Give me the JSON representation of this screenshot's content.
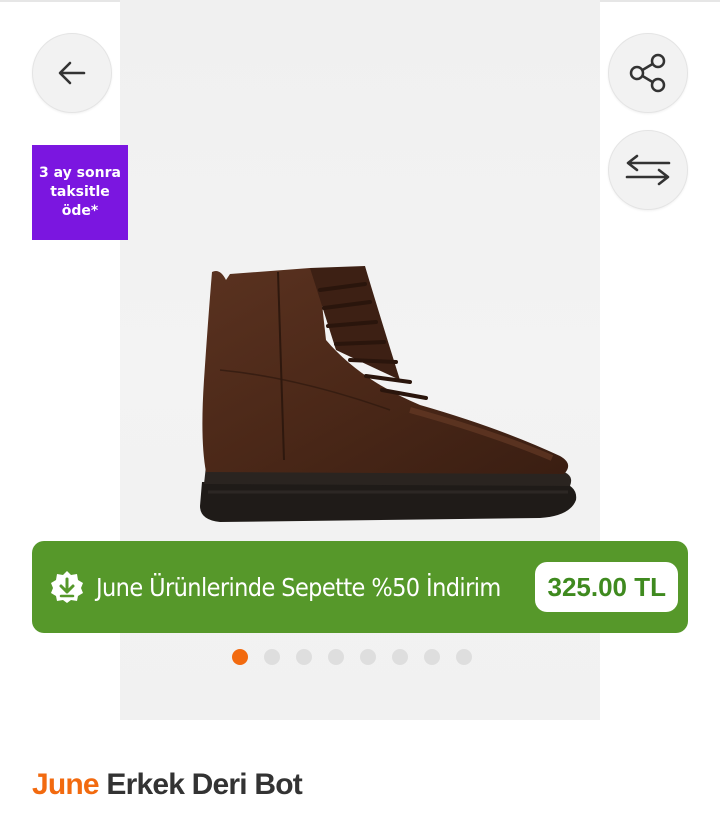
{
  "installment_badge": {
    "line1": "3 ay sonra",
    "line2": "taksitle",
    "line3": "öde*"
  },
  "promo": {
    "text": "June Ürünlerinde Sepette %50 İndirim",
    "price": "325.00 TL"
  },
  "gallery": {
    "total_images": 8,
    "active_index": 0
  },
  "product": {
    "brand": "June",
    "name": "Erkek Deri Bot"
  },
  "colors": {
    "accent": "#f26a0f",
    "promo_green": "#56982a",
    "badge_purple": "#7b16e0"
  },
  "icons": {
    "back": "arrow-left-icon",
    "share": "share-icon",
    "compare": "compare-arrows-icon",
    "promo": "discount-badge-icon"
  }
}
